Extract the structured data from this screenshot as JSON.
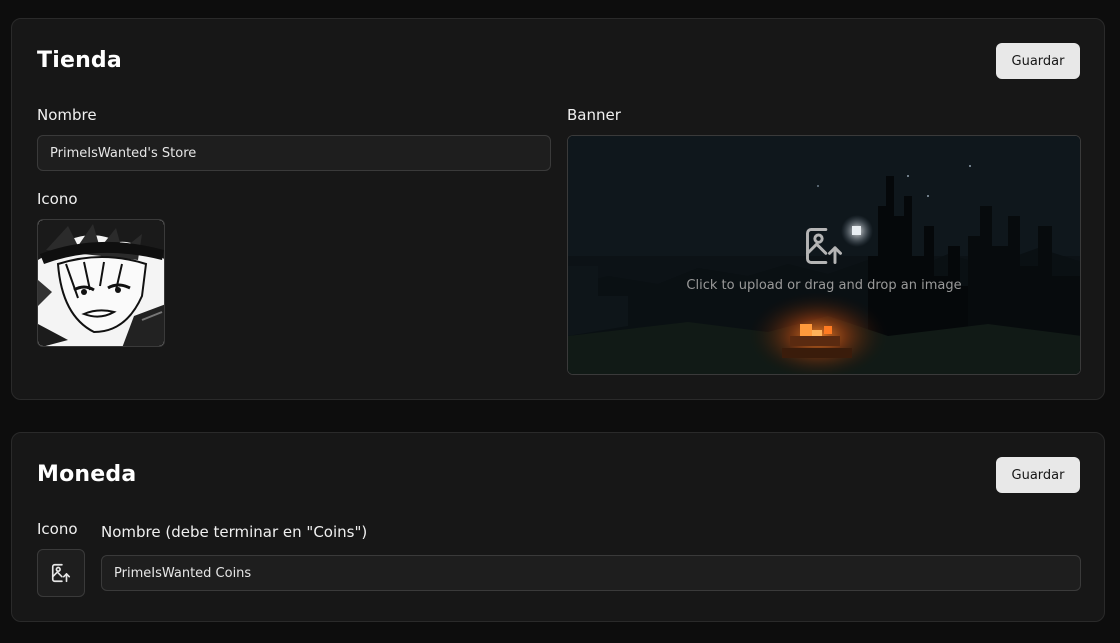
{
  "store": {
    "title": "Tienda",
    "save_label": "Guardar",
    "name_label": "Nombre",
    "name_value": "PrimeIsWanted's Store",
    "icon_label": "Icono",
    "banner_label": "Banner",
    "banner_upload_text": "Click to upload or drag and drop an image"
  },
  "currency": {
    "title": "Moneda",
    "save_label": "Guardar",
    "icon_label": "Icono",
    "name_label": "Nombre (debe terminar en \"Coins\")",
    "name_value": "PrimeIsWanted Coins"
  },
  "icons": {
    "banner_upload": "image-upload-icon",
    "coin_upload": "image-upload-icon"
  },
  "colors": {
    "background": "#0d0d0d",
    "card": "#171717",
    "border": "#2a2a2a",
    "button": "#e8e8e8",
    "button_text": "#161616"
  }
}
